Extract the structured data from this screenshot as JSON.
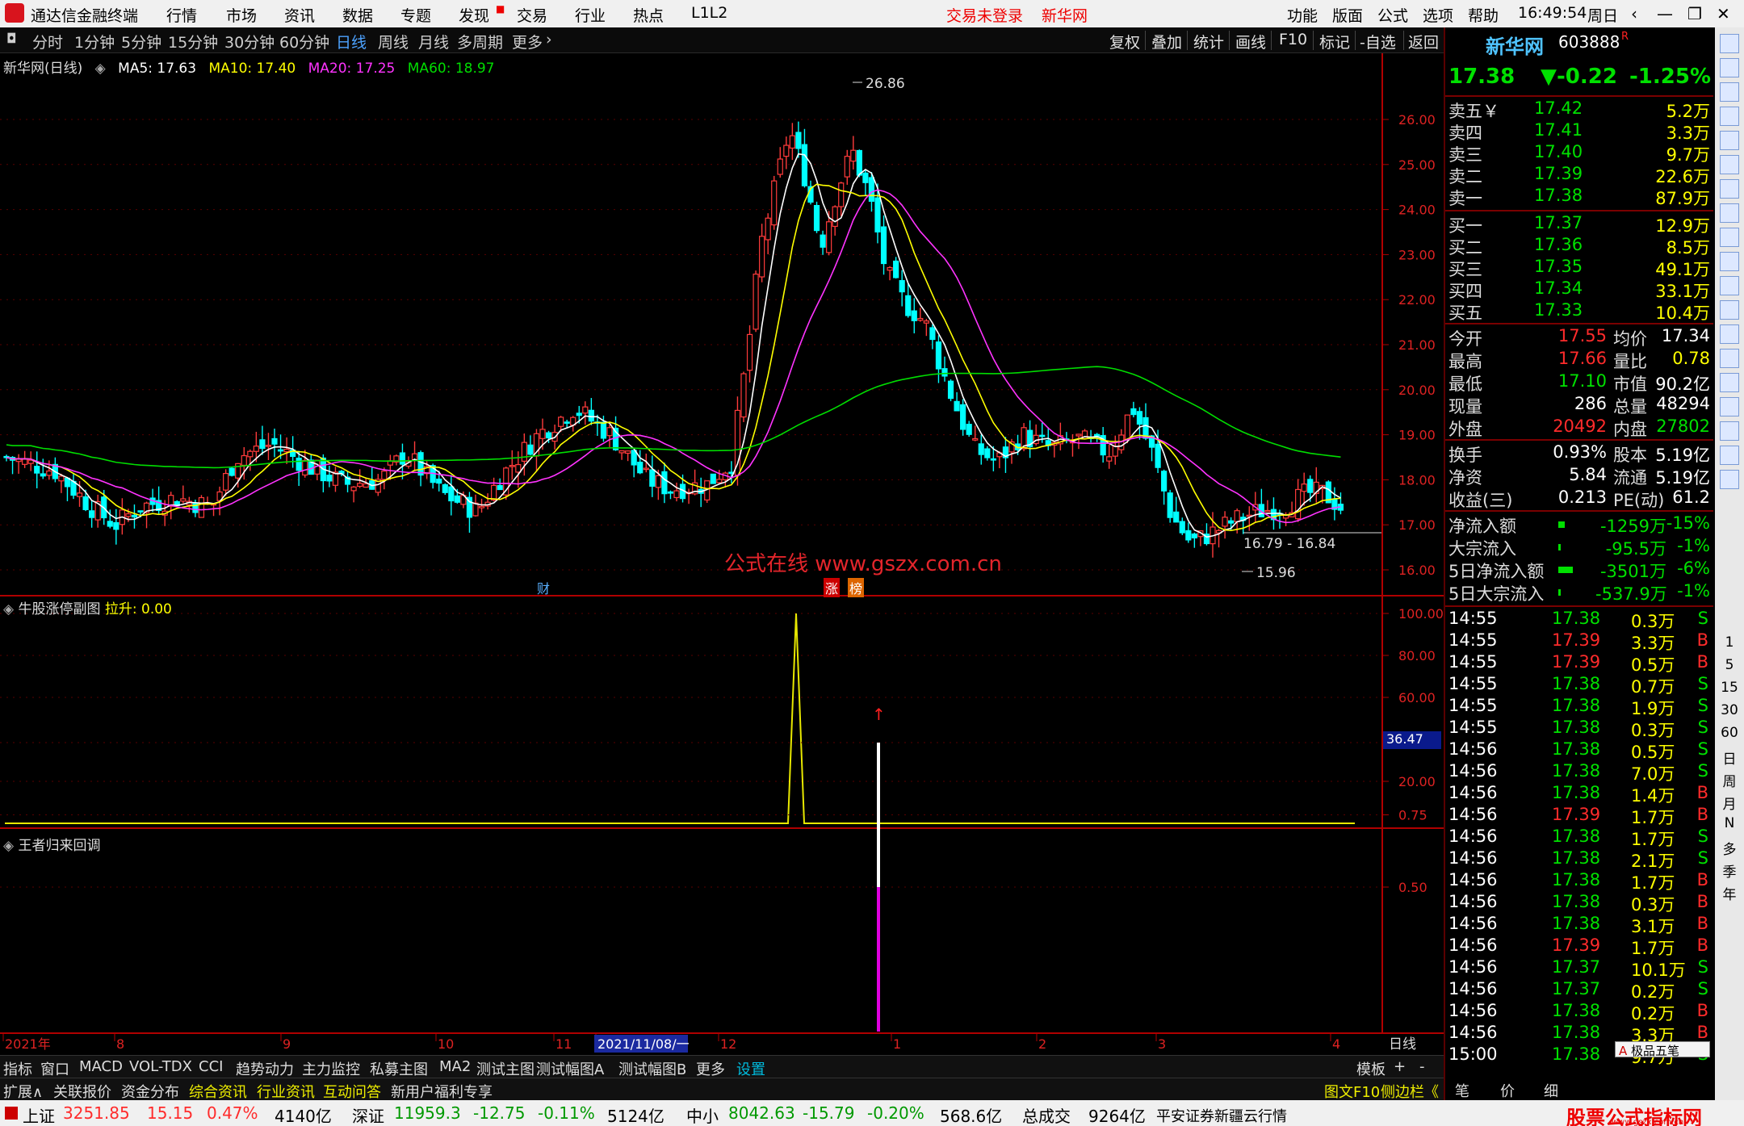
{
  "menubar": {
    "app_title": "通达信金融终端",
    "items": [
      "行情",
      "市场",
      "资讯",
      "数据",
      "专题",
      "发现",
      "交易",
      "行业",
      "热点",
      "L1L2"
    ],
    "trade_status": "交易未登录",
    "stock_name": "新华网",
    "right_items": [
      "功能",
      "版面",
      "公式",
      "选项",
      "帮助"
    ],
    "time": "16:49:54",
    "weekday": "周日"
  },
  "period_bar": {
    "periods": [
      "分时",
      "1分钟",
      "5分钟",
      "15分钟",
      "30分钟",
      "60分钟",
      "日线",
      "周线",
      "月线",
      "多周期",
      "更多"
    ],
    "active": "日线",
    "right_tools": [
      "复权",
      "叠加",
      "统计",
      "画线",
      "F10",
      "标记",
      "-自选",
      "返回"
    ]
  },
  "main_chart": {
    "title": "新华网(日线)",
    "ma": [
      {
        "label": "MA5: 17.63",
        "color": "#ffffff"
      },
      {
        "label": "MA10: 17.40",
        "color": "#ffff00"
      },
      {
        "label": "MA20: 17.25",
        "color": "#ff33ff"
      },
      {
        "label": "MA60: 18.97",
        "color": "#00dd00"
      }
    ],
    "watermark": "公式在线 www.gszx.com.cn",
    "high_label": "26.86",
    "low_label": "15.96",
    "range_label": "16.79 - 16.84",
    "markers": [
      "财",
      "涨",
      "榜"
    ]
  },
  "indicator1": {
    "title": "牛股涨停副图",
    "value_label": "拉升: 0.00",
    "current_value": "36.47"
  },
  "indicator2": {
    "title": "王者归来回调"
  },
  "chart_data": [
    {
      "type": "candlestick",
      "ylim": [
        16.0,
        26.0
      ],
      "y_ticks": [
        "26.00",
        "25.00",
        "24.00",
        "23.00",
        "22.00",
        "21.00",
        "20.00",
        "19.00",
        "18.00",
        "17.00",
        "16.00"
      ],
      "x_labels": [
        "2021年",
        "8",
        "9",
        "10",
        "11",
        "2021/11/08/一",
        "12",
        "1",
        "2",
        "3",
        "4"
      ],
      "series_ma": [
        {
          "name": "MA5",
          "value": 17.63
        },
        {
          "name": "MA10",
          "value": 17.4
        },
        {
          "name": "MA20",
          "value": 17.25
        },
        {
          "name": "MA60",
          "value": 18.97
        }
      ]
    },
    {
      "type": "line",
      "ylim": [
        0,
        100
      ],
      "y_ticks": [
        "100.00",
        "80.00",
        "60.00",
        "20.00"
      ],
      "series": [
        {
          "name": "拉升",
          "peak": 100,
          "baseline": 0
        }
      ]
    },
    {
      "type": "bar",
      "ylim": [
        0,
        1
      ],
      "y_ticks": [
        "1.00",
        "0.75",
        "0.50"
      ],
      "series": [
        {
          "values": [
            1.0
          ]
        }
      ]
    }
  ],
  "bottom_tabs": {
    "row1": [
      "指标",
      "窗口",
      "MACD",
      "VOL-TDX",
      "CCI",
      "趋势动力",
      "主力监控",
      "私募主图",
      "MA2",
      "测试主图",
      "测试幅图A",
      "测试幅图B",
      "更多",
      "设置"
    ],
    "row1_right": [
      "模板",
      "+",
      "-"
    ],
    "row2": [
      "扩展∧",
      "关联报价",
      "资金分布",
      "综合资讯",
      "行业资讯",
      "互动问答",
      "新用户福利专享"
    ],
    "row2_right": [
      "图文F10",
      "侧边栏《",
      "笔",
      "价",
      "细"
    ],
    "period_label": "日线"
  },
  "status": {
    "sh_label": "上证",
    "sh_val": "3251.85",
    "sh_chg": "15.15",
    "sh_pct": "0.47%",
    "sh_amt": "4140亿",
    "sz_label": "深证",
    "sz_val": "11959.3",
    "sz_chg": "-12.75",
    "sz_pct": "-0.11%",
    "sz_amt": "5124亿",
    "zx_label": "中小",
    "zx_val": "8042.63",
    "zx_chg": "-15.79",
    "zx_pct": "-0.20%",
    "zx_amt": "568.6亿",
    "total_label": "总成交",
    "total_val": "9264亿",
    "broker": "平安证券新疆云行情",
    "brand": "股票公式指标网",
    "brand_url": "www.gszx.com.cn",
    "extra": "极品五笔"
  },
  "quote": {
    "name": "新华网",
    "code": "603888",
    "flag": "R",
    "price": "17.38",
    "change": "▼-0.22",
    "pct": "-1.25%",
    "asks": [
      {
        "label": "卖五￥",
        "price": "17.42",
        "vol": "5.2万"
      },
      {
        "label": "卖四",
        "price": "17.41",
        "vol": "3.3万"
      },
      {
        "label": "卖三",
        "price": "17.40",
        "vol": "9.7万"
      },
      {
        "label": "卖二",
        "price": "17.39",
        "vol": "22.6万"
      },
      {
        "label": "卖一",
        "price": "17.38",
        "vol": "87.9万"
      }
    ],
    "bids": [
      {
        "label": "买一",
        "price": "17.37",
        "vol": "12.9万"
      },
      {
        "label": "买二",
        "price": "17.36",
        "vol": "8.5万"
      },
      {
        "label": "买三",
        "price": "17.35",
        "vol": "49.1万"
      },
      {
        "label": "买四",
        "price": "17.34",
        "vol": "33.1万"
      },
      {
        "label": "买五",
        "price": "17.33",
        "vol": "10.4万"
      }
    ],
    "stats": [
      {
        "l1": "今开",
        "v1": "17.55",
        "l2": "均价",
        "v2": "17.34",
        "c1": "red",
        "c2": "wht"
      },
      {
        "l1": "最高",
        "v1": "17.66",
        "l2": "量比",
        "v2": "0.78",
        "c1": "red",
        "c2": "yel"
      },
      {
        "l1": "最低",
        "v1": "17.10",
        "l2": "市值",
        "v2": "90.2亿",
        "c1": "grn",
        "c2": "wht"
      },
      {
        "l1": "现量",
        "v1": "286",
        "l2": "总量",
        "v2": "48294",
        "c1": "wht",
        "c2": "wht"
      },
      {
        "l1": "外盘",
        "v1": "20492",
        "l2": "内盘",
        "v2": "27802",
        "c1": "red",
        "c2": "grn"
      }
    ],
    "stats2": [
      {
        "l1": "换手",
        "v1": "0.93%",
        "l2": "股本",
        "v2": "5.19亿"
      },
      {
        "l1": "净资",
        "v1": "5.84",
        "l2": "流通",
        "v2": "5.19亿"
      },
      {
        "l1": "收益(三)",
        "v1": "0.213",
        "l2": "PE(动)",
        "v2": "61.2"
      }
    ],
    "flows": [
      {
        "label": "净流入额",
        "val": "-1259万",
        "pct": "-15%",
        "bar": 0.15
      },
      {
        "label": "大宗流入",
        "val": "-95.5万",
        "pct": "-1%",
        "bar": 0.02
      },
      {
        "label": "5日净流入额",
        "val": "-3501万",
        "pct": "-6%",
        "bar": 0.4
      },
      {
        "label": "5日大宗流入",
        "val": "-537.9万",
        "pct": "-1%",
        "bar": 0.02
      }
    ],
    "ticks": [
      {
        "t": "14:55",
        "p": "17.38",
        "v": "0.3万",
        "bs": "S"
      },
      {
        "t": "14:55",
        "p": "17.39",
        "v": "3.3万",
        "bs": "B"
      },
      {
        "t": "14:55",
        "p": "17.39",
        "v": "0.5万",
        "bs": "B"
      },
      {
        "t": "14:55",
        "p": "17.38",
        "v": "0.7万",
        "bs": "S"
      },
      {
        "t": "14:55",
        "p": "17.38",
        "v": "1.9万",
        "bs": "S"
      },
      {
        "t": "14:55",
        "p": "17.38",
        "v": "0.3万",
        "bs": "S"
      },
      {
        "t": "14:56",
        "p": "17.38",
        "v": "0.5万",
        "bs": "S"
      },
      {
        "t": "14:56",
        "p": "17.38",
        "v": "7.0万",
        "bs": "S"
      },
      {
        "t": "14:56",
        "p": "17.38",
        "v": "1.4万",
        "bs": "B"
      },
      {
        "t": "14:56",
        "p": "17.39",
        "v": "1.7万",
        "bs": "B"
      },
      {
        "t": "14:56",
        "p": "17.38",
        "v": "1.7万",
        "bs": "S"
      },
      {
        "t": "14:56",
        "p": "17.38",
        "v": "2.1万",
        "bs": "S"
      },
      {
        "t": "14:56",
        "p": "17.38",
        "v": "1.7万",
        "bs": "B"
      },
      {
        "t": "14:56",
        "p": "17.38",
        "v": "0.3万",
        "bs": "B"
      },
      {
        "t": "14:56",
        "p": "17.38",
        "v": "3.1万",
        "bs": "B"
      },
      {
        "t": "14:56",
        "p": "17.39",
        "v": "1.7万",
        "bs": "B"
      },
      {
        "t": "14:56",
        "p": "17.37",
        "v": "10.1万",
        "bs": "S"
      },
      {
        "t": "14:56",
        "p": "17.37",
        "v": "0.2万",
        "bs": "S"
      },
      {
        "t": "14:56",
        "p": "17.38",
        "v": "0.2万",
        "bs": "B"
      },
      {
        "t": "14:56",
        "p": "17.38",
        "v": "3.3万",
        "bs": "B"
      },
      {
        "t": "15:00",
        "p": "17.38",
        "v": "9.7万",
        "bs": "S"
      }
    ]
  },
  "sidebar": {
    "labels": [
      "1",
      "5",
      "15",
      "30",
      "60",
      "日",
      "周",
      "月",
      "N",
      "多",
      "季",
      "年"
    ]
  },
  "colors": {
    "up": "#ff3b3b",
    "down": "#00ffff",
    "ma5": "#ffffff",
    "ma10": "#ffff00",
    "ma20": "#ff33ff",
    "ma60": "#00dd00",
    "axis": "#c00000"
  }
}
